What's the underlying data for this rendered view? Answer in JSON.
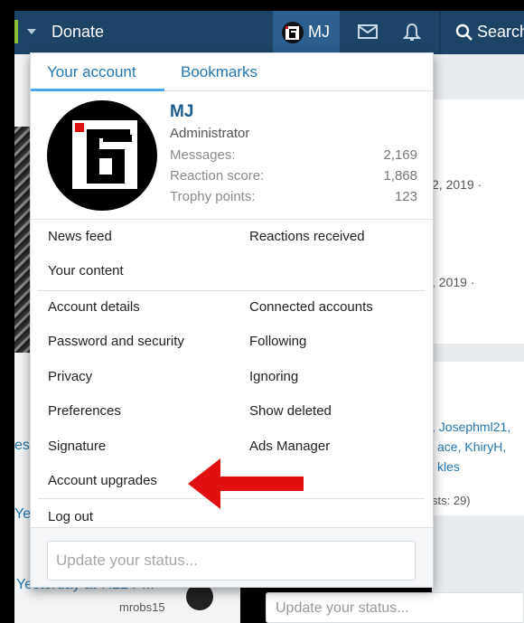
{
  "navbar": {
    "donate": "Donate",
    "user_initials": "MJ",
    "search": "Search"
  },
  "background": {
    "date1": "2, 2019 ·",
    "date2": ", 2019 ·",
    "names1": ", Josephml21,",
    "names2": "ace, KhiryH,",
    "names3": "kles",
    "guests": "sts: 29)",
    "left_fragment_1": "es",
    "left_fragment_2": "Ye",
    "last_time": "Yesterday at 7:22 PM",
    "member": "mrobs15",
    "status_placeholder": "Update your status..."
  },
  "menu": {
    "tabs": [
      {
        "label": "Your account",
        "active": true
      },
      {
        "label": "Bookmarks",
        "active": false
      }
    ],
    "profile": {
      "name": "MJ",
      "role": "Administrator",
      "stats": [
        {
          "label": "Messages:",
          "value": "2,169"
        },
        {
          "label": "Reaction score:",
          "value": "1,868"
        },
        {
          "label": "Trophy points:",
          "value": "123"
        }
      ]
    },
    "links": {
      "news_feed": "News feed",
      "reactions_received": "Reactions received",
      "your_content": "Your content",
      "account_details": "Account details",
      "connected_accounts": "Connected accounts",
      "password_security": "Password and security",
      "following": "Following",
      "privacy": "Privacy",
      "ignoring": "Ignoring",
      "preferences": "Preferences",
      "show_deleted": "Show deleted",
      "signature": "Signature",
      "ads_manager": "Ads Manager",
      "account_upgrades": "Account upgrades",
      "log_out": "Log out"
    },
    "status_placeholder": "Update your status..."
  },
  "colors": {
    "navbar": "#1d4466",
    "accent_link": "#2577b1",
    "arrow": "#e01010"
  }
}
